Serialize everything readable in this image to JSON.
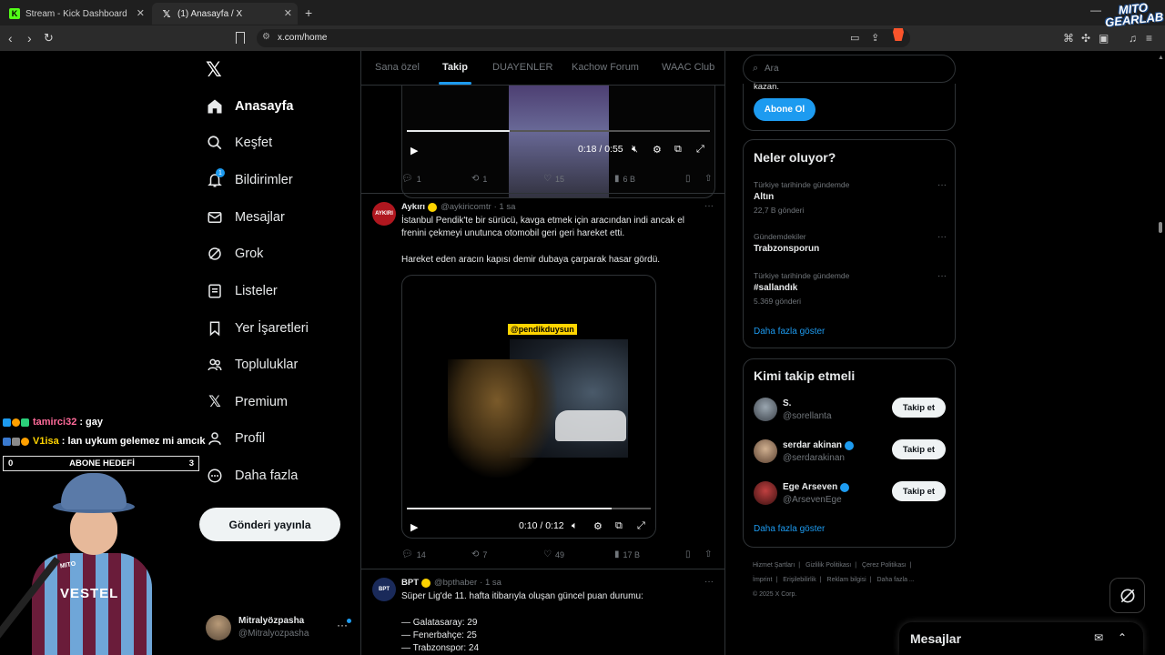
{
  "browser": {
    "tabs": [
      {
        "title": "Stream - Kick Dashboard",
        "active": false
      },
      {
        "title": "(1) Anasayfa / X",
        "active": true
      }
    ],
    "url": "x.com/home"
  },
  "sidebar": {
    "items": [
      {
        "label": "Anasayfa",
        "icon": "home-icon",
        "active": true
      },
      {
        "label": "Keşfet",
        "icon": "search-icon"
      },
      {
        "label": "Bildirimler",
        "icon": "bell-icon",
        "badge": "1"
      },
      {
        "label": "Mesajlar",
        "icon": "mail-icon"
      },
      {
        "label": "Grok",
        "icon": "grok-icon"
      },
      {
        "label": "Listeler",
        "icon": "list-icon"
      },
      {
        "label": "Yer İşaretleri",
        "icon": "bookmark-icon"
      },
      {
        "label": "Topluluklar",
        "icon": "communities-icon"
      },
      {
        "label": "Premium",
        "icon": "x-premium-icon"
      },
      {
        "label": "Profil",
        "icon": "profile-icon"
      },
      {
        "label": "Daha fazla",
        "icon": "more-circle-icon"
      }
    ],
    "post_button": "Gönderi yayınla",
    "account": {
      "name": "Mitralyözpasha",
      "handle": "@Mitralyozpasha"
    }
  },
  "feed_tabs": [
    "Sana özel",
    "Takip",
    "DUAYENLER",
    "Kachow Forum",
    "WAAC Club"
  ],
  "tweets": [
    {
      "video": {
        "time": "0:18 / 0:55",
        "progress": 0.34
      },
      "stats": {
        "replies": "1",
        "reposts": "1",
        "likes": "15",
        "views": "6 B"
      }
    },
    {
      "author": "Aykırı",
      "handle": "@aykiricomtr",
      "time": "· 1 sa",
      "avatar_text": "AYKIRI",
      "text": "İstanbul Pendik'te bir sürücü, kavga etmek için aracından indi ancak el\nfrenini çekmeyi unutunca otomobil geri geri hareket etti.\n\nHareket eden aracın kapısı demir dubaya çarparak hasar gördü.",
      "video": {
        "overlay_tag": "@pendikduysun",
        "time": "0:10 / 0:12",
        "progress": 0.84
      },
      "stats": {
        "replies": "14",
        "reposts": "7",
        "likes": "49",
        "views": "17 B"
      }
    },
    {
      "author": "BPT",
      "handle": "@bpthaber",
      "time": "· 1 sa",
      "avatar_text": "BPT",
      "text": "Süper Lig'de 11. hafta itibarıyla oluşan güncel puan durumu:\n\n— Galatasaray: 29\n— Fenerbahçe: 25\n— Trabzonspor: 24"
    }
  ],
  "right": {
    "search_placeholder": "Ara",
    "subscribe": {
      "cut_text": "kazan.",
      "button": "Abone Ol"
    },
    "trends_title": "Neler oluyor?",
    "trends": [
      {
        "context": "Türkiye tarihinde gündemde",
        "name": "Altın",
        "count": "22,7 B gönderi"
      },
      {
        "context": "Gündemdekiler",
        "name": "Trabzonsporun",
        "count": ""
      },
      {
        "context": "Türkiye tarihinde gündemde",
        "name": "#sallandık",
        "count": "5.369 gönderi"
      }
    ],
    "trends_more": "Daha fazla göster",
    "follow_title": "Kimi takip etmeli",
    "follow": [
      {
        "name": "S.",
        "handle": "@sorellanta",
        "verified": false,
        "button": "Takip et"
      },
      {
        "name": "serdar akinan",
        "handle": "@serdarakinan",
        "verified": true,
        "button": "Takip et"
      },
      {
        "name": "Ege Arseven",
        "handle": "@ArsevenEge",
        "verified": true,
        "button": "Takip et"
      }
    ],
    "follow_more": "Daha fazla göster",
    "footer": [
      "Hizmet Şartları",
      "|",
      "Gizlilik Politikası",
      "|",
      "Çerez Politikası",
      "|",
      "İmprint",
      "|",
      "Erişilebilirlik",
      "|",
      "Reklam bilgisi",
      "|",
      "Daha fazla ...",
      "© 2025 X Corp."
    ]
  },
  "messages_drawer": {
    "title": "Mesajlar"
  },
  "stream_overlay": {
    "chat": [
      {
        "user": "tamirci32",
        "message": ": gay",
        "color": "#ff6b9a"
      },
      {
        "user": "V1isa",
        "message": ": lan uykum gelemez mi amcık",
        "color": "#ffd400"
      }
    ],
    "goal": {
      "left": "0",
      "label": "ABONE HEDEFİ",
      "right": "3"
    },
    "shirt_text": "VESTEL",
    "logo_text": "MITO GEARLAB"
  }
}
